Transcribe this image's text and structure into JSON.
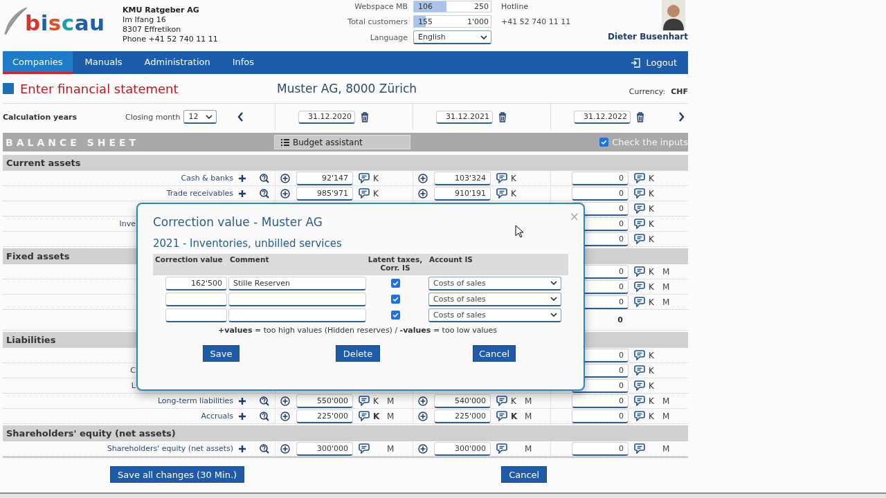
{
  "header": {
    "logo": "biscau",
    "company": {
      "name": "KMU Ratgeber AG",
      "lines": [
        "Im Ifang 16",
        "8307 Effretikon",
        "Phone +41 52 740 11 11"
      ]
    },
    "meters": [
      {
        "label": "Webspace MB",
        "used": "106",
        "total": "250",
        "level": 0.424
      },
      {
        "label": "Total customers",
        "used": "155",
        "total": "1'000",
        "level": 0.155
      }
    ],
    "language": {
      "label": "Language",
      "value": "English"
    },
    "hotline": {
      "label": "Hotline",
      "phone": "+41 52 740 11 11"
    },
    "user": {
      "name": "Dieter Busenhart"
    }
  },
  "nav": {
    "items": [
      {
        "label": "Companies",
        "selected": true
      },
      {
        "label": "Manuals",
        "selected": false
      },
      {
        "label": "Administration",
        "selected": false
      },
      {
        "label": "Infos",
        "selected": false
      }
    ],
    "logout": "Logout"
  },
  "page": {
    "title": "Enter financial statement",
    "company": "Muster AG, 8000 Zürich",
    "currency_label": "Currency:",
    "currency": "CHF"
  },
  "years_row": {
    "label": "Calculation years",
    "closing_month_label": "Closing month",
    "closing_month": "12",
    "years": [
      {
        "date": "31.12.2020",
        "expandable": true
      },
      {
        "date": "31.12.2021",
        "expandable": true
      },
      {
        "date": "31.12.2022",
        "expandable": false
      }
    ]
  },
  "balance_bar": {
    "title": "BALANCE SHEET",
    "budget_button": "Budget assistant",
    "check_inputs": {
      "label": "Check the inputs",
      "checked": true
    }
  },
  "sections": [
    {
      "title": "Current assets",
      "rows": [
        {
          "kind": "full",
          "label": "Cash & banks",
          "cells": [
            {
              "value": "92'147",
              "k": "K",
              "bold": false
            },
            {
              "value": "103'324",
              "k": "K",
              "bold": false
            },
            {
              "value": "0",
              "k": "K",
              "bold": false
            }
          ]
        },
        {
          "kind": "full",
          "label": "Trade receivables",
          "cells": [
            {
              "value": "985'971",
              "k": "K",
              "bold": false
            },
            {
              "value": "910'191",
              "k": "K",
              "bold": false
            },
            {
              "value": "0",
              "k": "K",
              "bold": false
            }
          ]
        },
        {
          "kind": "covered",
          "cells": [
            {
              "value": "0",
              "k": "K",
              "bold": false
            }
          ]
        },
        {
          "kind": "covered",
          "label": "Inve",
          "cells": [
            {
              "value": "0",
              "k": "K",
              "bold": false
            }
          ]
        },
        {
          "kind": "covered",
          "cells": [
            {
              "value": "0",
              "k": "K",
              "bold": false
            }
          ]
        }
      ]
    },
    {
      "title": "Fixed assets",
      "rows": [
        {
          "kind": "covered",
          "cells": [
            {
              "value": "0",
              "k": "K",
              "bold": false,
              "m": "M"
            }
          ]
        },
        {
          "kind": "covered",
          "cells": [
            {
              "value": "0",
              "k": "K",
              "bold": false,
              "m": "M"
            }
          ]
        },
        {
          "kind": "covered",
          "cells": [
            {
              "value": "0",
              "k": "K",
              "bold": false,
              "m": "M"
            }
          ]
        },
        {
          "kind": "total",
          "cells": [
            {
              "value": "0"
            }
          ]
        }
      ]
    },
    {
      "title": "Liabilities",
      "rows": [
        {
          "kind": "covered",
          "cells": [
            {
              "value": "0",
              "k": "K",
              "bold": false
            }
          ]
        },
        {
          "kind": "covered",
          "label": "C",
          "cells": [
            {
              "value": "0",
              "k": "K",
              "bold": false
            }
          ]
        },
        {
          "kind": "covered",
          "label": "L",
          "cells": [
            {
              "value": "0",
              "k": "K",
              "bold": false
            }
          ]
        },
        {
          "kind": "full",
          "label": "Long-term liabilities",
          "cells": [
            {
              "value": "550'000",
              "k": "K",
              "bold": false,
              "m": "M"
            },
            {
              "value": "540'000",
              "k": "K",
              "bold": false,
              "m": "M"
            },
            {
              "value": "0",
              "k": "K",
              "bold": false,
              "m": "M"
            }
          ]
        },
        {
          "kind": "full",
          "label": "Accruals",
          "cells": [
            {
              "value": "225'000",
              "k": "K",
              "bold": true,
              "m": "M"
            },
            {
              "value": "225'000",
              "k": "K",
              "bold": true,
              "m": "M"
            },
            {
              "value": "0",
              "k": "K",
              "bold": false,
              "m": "M"
            }
          ]
        }
      ]
    },
    {
      "title": "Shareholders' equity (net assets)",
      "rows": [
        {
          "kind": "full",
          "label": "Shareholders' equity (net assets)",
          "cells": [
            {
              "value": "300'000",
              "m": "M"
            },
            {
              "value": "300'000",
              "m": "M"
            },
            {
              "value": "0",
              "m": "M"
            }
          ]
        }
      ]
    }
  ],
  "footer": {
    "save": "Save all changes (30 Min.)",
    "cancel": "Cancel"
  },
  "dialog": {
    "title": "Correction value - Muster AG",
    "subtitle": "2021 - Inventories, unbilled services",
    "close": "×",
    "columns": [
      "Correction value",
      "Comment",
      "Latent taxes, Corr. IS",
      "Account IS"
    ],
    "rows": [
      {
        "value": "162'500",
        "comment": "Stille Reserven",
        "checked": true,
        "account": "Costs of sales"
      },
      {
        "checked": true,
        "account": "Costs of sales"
      },
      {
        "checked": true,
        "account": "Costs of sales"
      }
    ],
    "note": "**+values** = too high values (Hidden reserves) / **-values** = too low values",
    "buttons": [
      "Save",
      "Delete",
      "Cancel"
    ]
  }
}
